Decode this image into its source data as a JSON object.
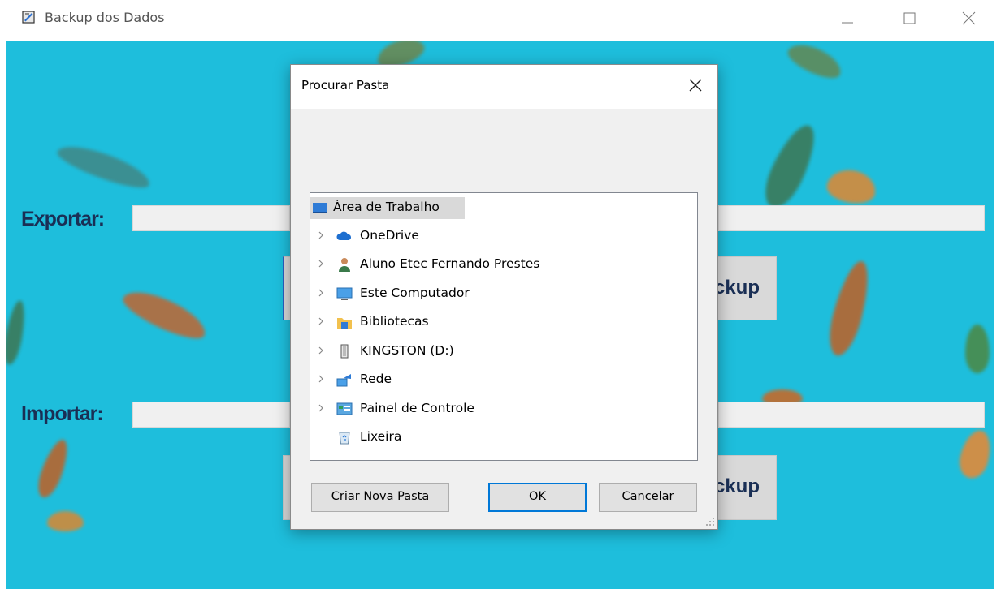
{
  "window": {
    "title": "Backup dos Dados",
    "controls": [
      "minimize-icon",
      "maximize-icon",
      "close-icon"
    ]
  },
  "main": {
    "export_label": "Exportar:",
    "import_label": "Importar:",
    "export_button_label": "ckup",
    "import_button_label": "ckup",
    "background_color": "#1ebedc",
    "label_color": "#1a2f55"
  },
  "dialog": {
    "title": "Procurar Pasta",
    "tree": [
      {
        "label": "Área de Trabalho",
        "icon": "desktop-icon",
        "expandable": false,
        "selected": true,
        "indent": 0
      },
      {
        "label": "OneDrive",
        "icon": "cloud-icon",
        "expandable": true,
        "selected": false,
        "indent": 1
      },
      {
        "label": "Aluno Etec Fernando Prestes",
        "icon": "user-icon",
        "expandable": true,
        "selected": false,
        "indent": 1
      },
      {
        "label": "Este Computador",
        "icon": "computer-icon",
        "expandable": true,
        "selected": false,
        "indent": 1
      },
      {
        "label": "Bibliotecas",
        "icon": "library-folder-icon",
        "expandable": true,
        "selected": false,
        "indent": 1
      },
      {
        "label": "KINGSTON (D:)",
        "icon": "usb-drive-icon",
        "expandable": true,
        "selected": false,
        "indent": 1
      },
      {
        "label": "Rede",
        "icon": "network-icon",
        "expandable": true,
        "selected": false,
        "indent": 1
      },
      {
        "label": "Painel de Controle",
        "icon": "control-panel-icon",
        "expandable": true,
        "selected": false,
        "indent": 1
      },
      {
        "label": "Lixeira",
        "icon": "recycle-bin-icon",
        "expandable": false,
        "selected": false,
        "indent": 1
      }
    ],
    "new_folder_label": "Criar Nova Pasta",
    "ok_label": "OK",
    "cancel_label": "Cancelar"
  }
}
